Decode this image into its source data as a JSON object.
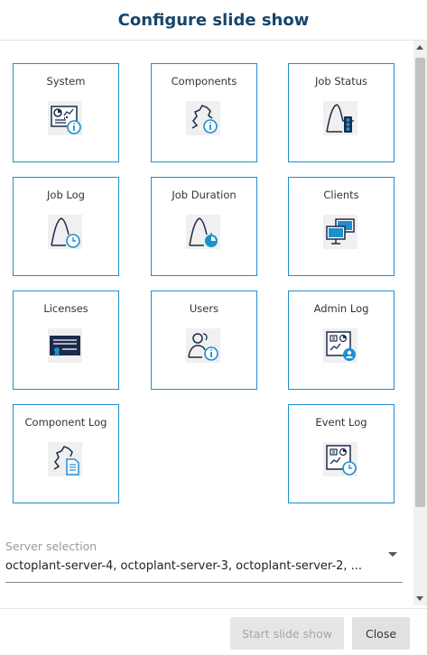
{
  "dialog": {
    "title": "Configure slide show"
  },
  "tiles": [
    {
      "label": "System",
      "icon": "system-info-icon"
    },
    {
      "label": "Components",
      "icon": "components-info-icon"
    },
    {
      "label": "Job Status",
      "icon": "job-status-traffic-light-icon"
    },
    {
      "label": "Job Log",
      "icon": "job-log-clock-icon"
    },
    {
      "label": "Job Duration",
      "icon": "job-duration-stopwatch-icon"
    },
    {
      "label": "Clients",
      "icon": "clients-monitors-icon"
    },
    {
      "label": "Licenses",
      "icon": "license-certificate-icon"
    },
    {
      "label": "Users",
      "icon": "users-info-icon"
    },
    {
      "label": "Admin Log",
      "icon": "admin-log-user-icon"
    },
    {
      "label": "Component Log",
      "icon": "component-log-document-icon"
    },
    {
      "label": "Event Log",
      "icon": "event-log-clock-icon"
    }
  ],
  "server_selection": {
    "label": "Server selection",
    "value": "octoplant-server-4, octoplant-server-3, octoplant-server-2, ..."
  },
  "buttons": {
    "start": "Start slide show",
    "close": "Close"
  },
  "colors": {
    "accent": "#1d8fcf",
    "title": "#17456b",
    "icon_navy": "#1b2b4b"
  }
}
